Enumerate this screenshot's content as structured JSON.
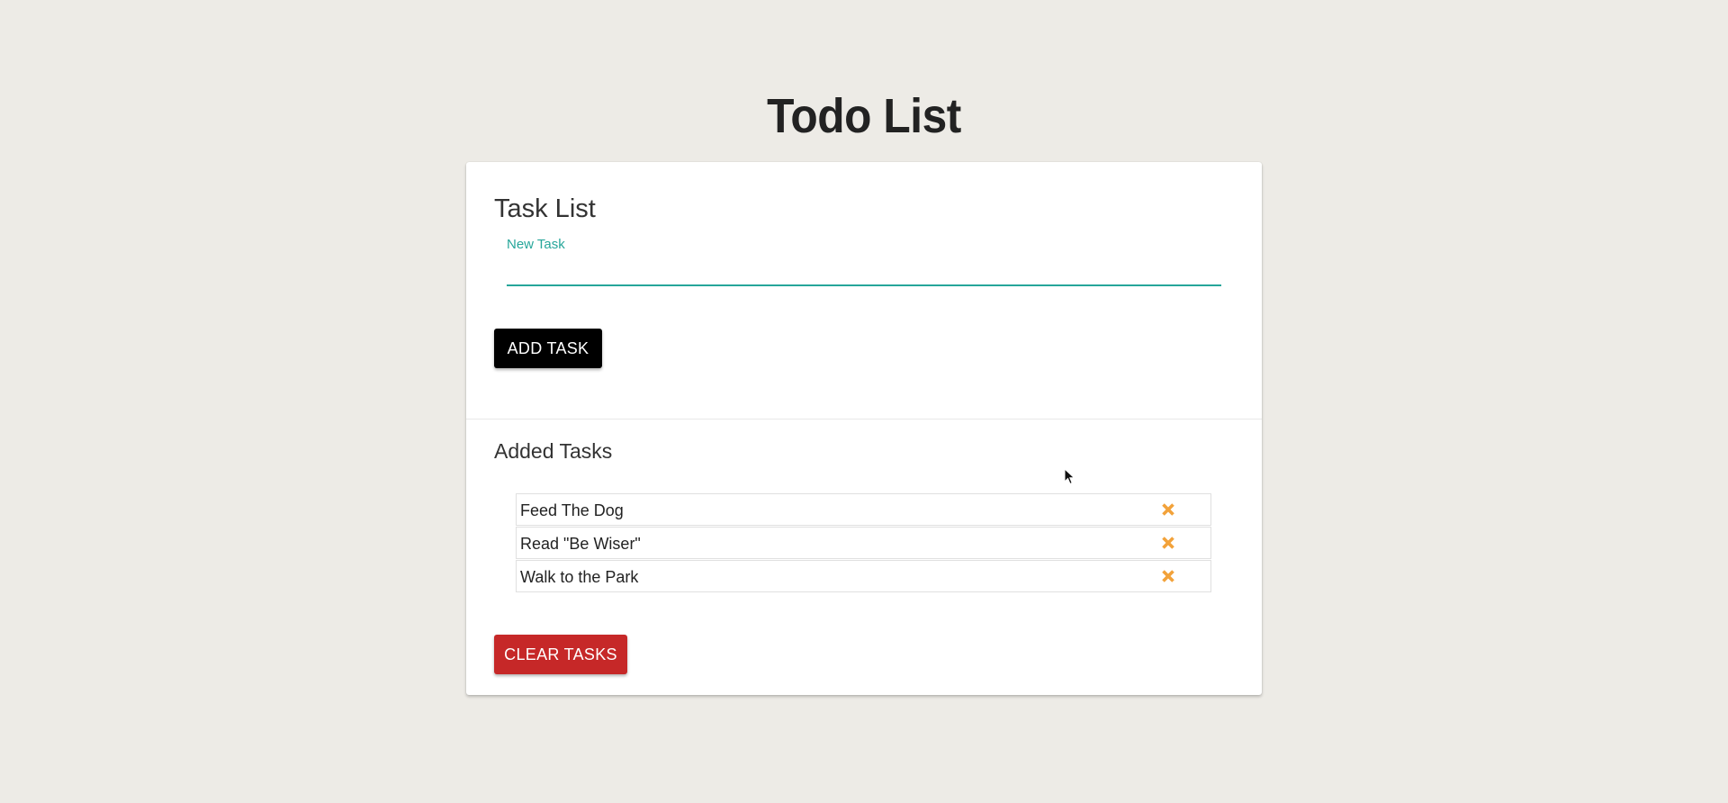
{
  "app": {
    "title": "Todo List"
  },
  "card": {
    "heading": "Task List"
  },
  "new_task": {
    "label": "New Task",
    "value": "",
    "placeholder": ""
  },
  "add_button": {
    "label": "ADD TASK"
  },
  "tasks_section": {
    "heading": "Added Tasks"
  },
  "tasks": [
    {
      "text": "Feed The Dog",
      "delete_icon": "close-icon"
    },
    {
      "text": "Read \"Be Wiser\"",
      "delete_icon": "close-icon"
    },
    {
      "text": "Walk to the Park",
      "delete_icon": "close-icon"
    }
  ],
  "clear_button": {
    "label": "CLEAR TASKS"
  },
  "colors": {
    "background": "#edebe6",
    "accent": "#26a69a",
    "add_button": "#000000",
    "clear_button": "#c62828",
    "delete_icon": "#f2a23a"
  }
}
